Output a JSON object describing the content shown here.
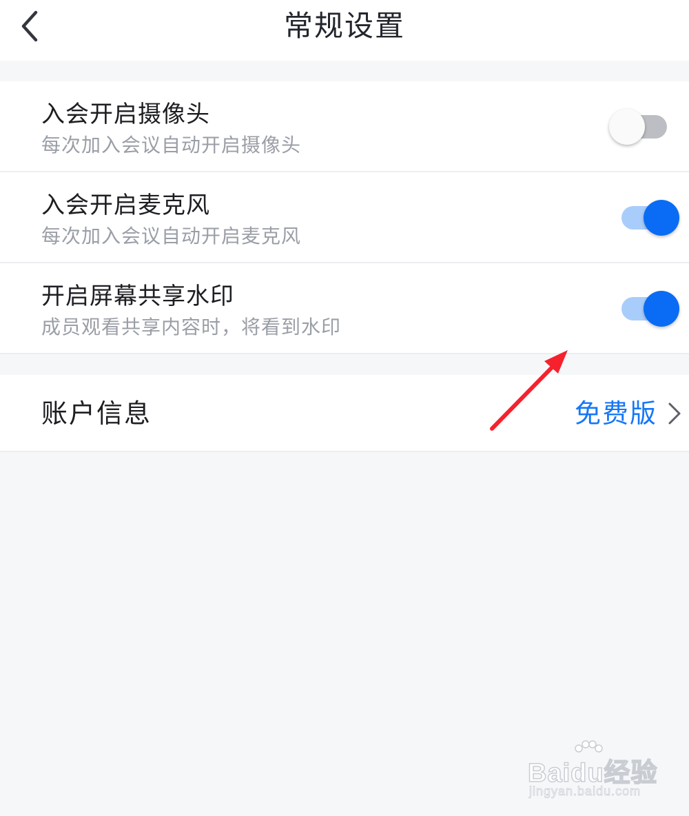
{
  "header": {
    "title": "常规设置",
    "back_icon": "chevron-left-icon"
  },
  "settings": [
    {
      "title": "入会开启摄像头",
      "subtitle": "每次加入会议自动开启摄像头",
      "enabled": false
    },
    {
      "title": "入会开启麦克风",
      "subtitle": "每次加入会议自动开启麦克风",
      "enabled": true
    },
    {
      "title": "开启屏幕共享水印",
      "subtitle": "成员观看共享内容时，将看到水印",
      "enabled": true
    }
  ],
  "account": {
    "label": "账户信息",
    "value": "免费版",
    "chevron_icon": "chevron-right-icon"
  },
  "annotation": {
    "type": "red-arrow",
    "color": "#f5222d"
  },
  "watermark": {
    "brand": "Baidu经验",
    "url": "jingyan.baidu.com"
  },
  "colors": {
    "accent": "#0a6cf4",
    "link": "#1677f8",
    "background": "#f6f7f9"
  }
}
